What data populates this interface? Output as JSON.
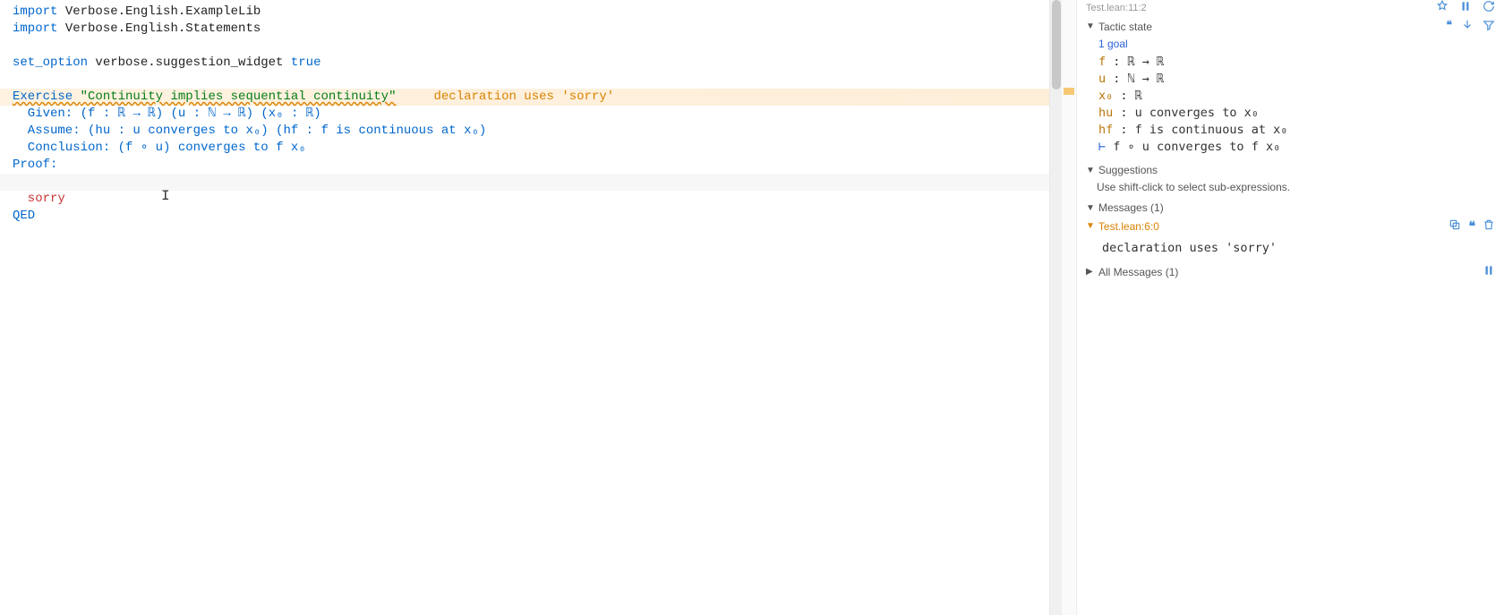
{
  "editor": {
    "lines": {
      "import1_kw": "import",
      "import1_rest": " Verbose.English.ExampleLib",
      "import2_kw": "import",
      "import2_rest": " Verbose.English.Statements",
      "setopt_kw": "set_option",
      "setopt_mid": " verbose.suggestion_widget ",
      "setopt_val": "true",
      "exercise_kw": "Exercise ",
      "exercise_str": "\"Continuity implies sequential continuity\"",
      "exercise_warn": "     declaration uses 'sorry'",
      "given_kw": "  Given: ",
      "given_body": "(f : ℝ → ℝ) (u : ℕ → ℝ) (x₀ : ℝ)",
      "assume_kw": "  Assume: ",
      "assume_body": "(hu : u converges to x₀) (hf : f is continuous at x₀)",
      "concl_kw": "  Conclusion: ",
      "concl_body": "(f ∘ u) converges to f x₀",
      "proof_kw": "Proof:",
      "sorry_kw": "  sorry",
      "qed_kw": "QED"
    }
  },
  "info": {
    "top_tab": "Test.lean:11:2",
    "tactic_state_label": "Tactic state",
    "goal_count": "1 goal",
    "hyps": [
      {
        "name": "f",
        "sep": " : ",
        "body": "ℝ → ℝ"
      },
      {
        "name": "u",
        "sep": " : ",
        "body": "ℕ → ℝ"
      },
      {
        "name": "x₀",
        "sep": " : ",
        "body": "ℝ"
      },
      {
        "name": "hu",
        "sep": " : ",
        "body": "u converges to x₀"
      },
      {
        "name": "hf",
        "sep": " : ",
        "body": "f is continuous at x₀"
      }
    ],
    "goal_turnstile": "⊢ ",
    "goal_body": "f ∘ u converges to f x₀",
    "suggestions_label": "Suggestions",
    "suggestions_hint": "Use shift-click to select sub-expressions.",
    "messages_label": "Messages (1)",
    "msg_source": "Test.lean:6:0",
    "msg_body": "declaration uses 'sorry'",
    "all_messages_label": "All Messages (1)"
  }
}
